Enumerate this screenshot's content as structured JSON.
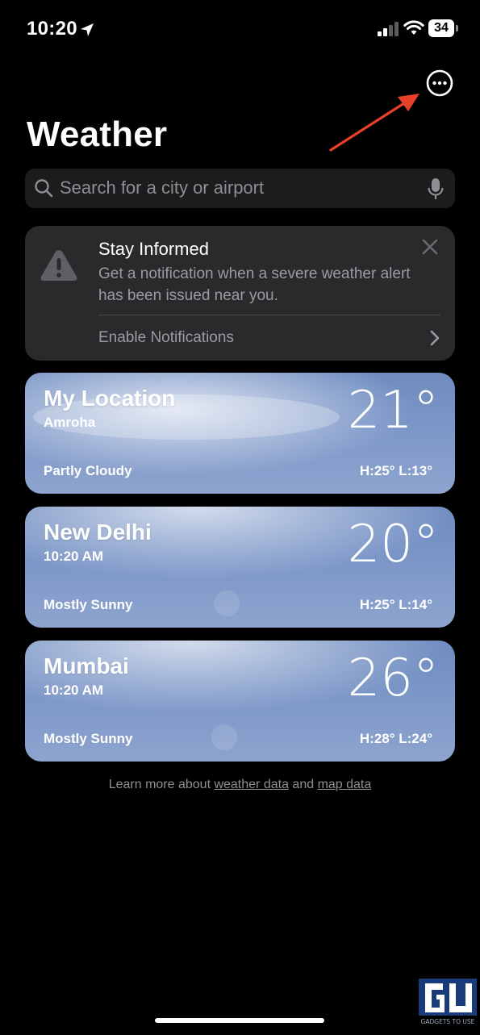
{
  "status_bar": {
    "time": "10:20",
    "battery": "34"
  },
  "header": {
    "title": "Weather"
  },
  "search": {
    "placeholder": "Search for a city or airport"
  },
  "alert": {
    "title": "Stay Informed",
    "body": "Get a notification when a severe weather alert has been issued near you.",
    "action": "Enable Notifications"
  },
  "locations": [
    {
      "name": "My Location",
      "subtitle": "Amroha",
      "temp": "21°",
      "condition": "Partly Cloudy",
      "hilo": "H:25°  L:13°"
    },
    {
      "name": "New Delhi",
      "subtitle": "10:20 AM",
      "temp": "20°",
      "condition": "Mostly Sunny",
      "hilo": "H:25°  L:14°"
    },
    {
      "name": "Mumbai",
      "subtitle": "10:20 AM",
      "temp": "26°",
      "condition": "Mostly Sunny",
      "hilo": "H:28°  L:24°"
    }
  ],
  "footer": {
    "prefix": "Learn more about ",
    "link1": "weather data",
    "middle": " and ",
    "link2": "map data"
  },
  "watermark": {
    "text": "GADGETS TO USE"
  },
  "colors": {
    "background": "#000000",
    "card": "#2a2a2c",
    "search_bg": "#1c1c1e",
    "annotation_arrow": "#e8402a"
  }
}
